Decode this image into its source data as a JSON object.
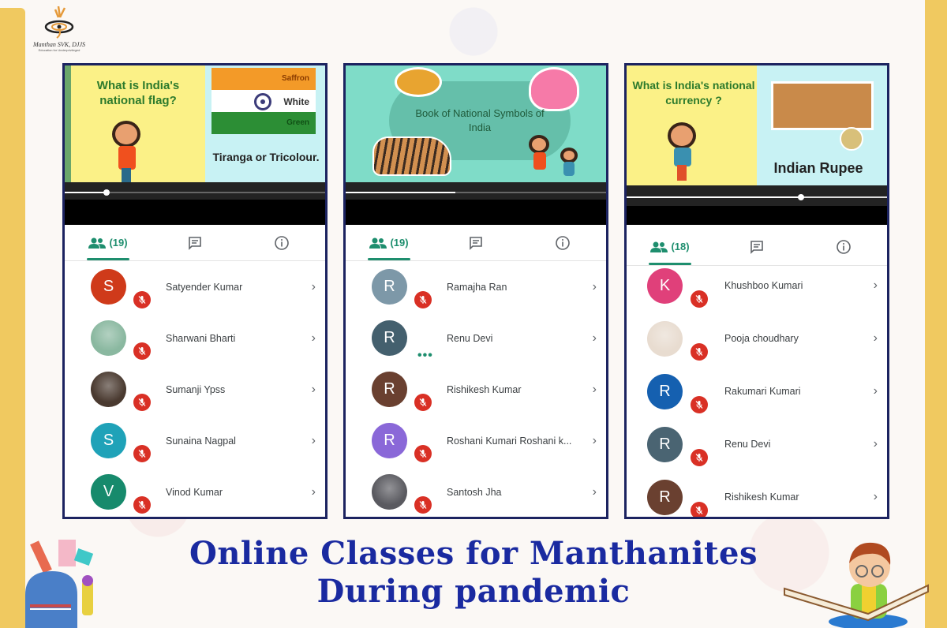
{
  "logo": {
    "title": "Manthan SVK, DJJS",
    "subtitle": "Education for Underprivileged"
  },
  "headline": {
    "line1": "Online Classes for Manthanites",
    "line2": "During pandemic"
  },
  "colors": {
    "accent_green": "#1e8e6e",
    "mute_red": "#d93025",
    "headline_blue": "#1a2aa0",
    "frame_navy": "#1c2360",
    "side_yellow": "#f0c960"
  },
  "phones": [
    {
      "video": {
        "question": "What is India's national flag?",
        "flag_labels": [
          "Saffron",
          "White",
          "Green"
        ],
        "caption": "Tiranga or Tricolour.",
        "progress": 0.16
      },
      "tabs": {
        "participants_count": "(19)",
        "people_icon": "people-icon",
        "chat_icon": "chat-icon",
        "info_icon": "info-icon"
      },
      "participants": [
        {
          "initial": "S",
          "name": "Satyender Kumar",
          "color": "#cf3a1a",
          "status": "muted"
        },
        {
          "initial": "",
          "name": "Sharwani Bharti",
          "color": "#8ab8a0",
          "status": "muted",
          "photo": true
        },
        {
          "initial": "",
          "name": "Sumanji Ypss",
          "color": "#4a3a30",
          "status": "muted",
          "photo": true
        },
        {
          "initial": "S",
          "name": "Sunaina Nagpal",
          "color": "#1fa2b8",
          "status": "muted"
        },
        {
          "initial": "V",
          "name": "Vinod Kumar",
          "color": "#178a6c",
          "status": "muted"
        }
      ]
    },
    {
      "video": {
        "title": "Book of National Symbols of India",
        "progress": 0.42
      },
      "tabs": {
        "participants_count": "(19)",
        "people_icon": "people-icon",
        "chat_icon": "chat-icon",
        "info_icon": "info-icon"
      },
      "participants": [
        {
          "initial": "R",
          "name": "Ramajha Ran",
          "color": "#7d98a8",
          "status": "muted"
        },
        {
          "initial": "R",
          "name": "Renu Devi",
          "color": "#44606e",
          "status": "speaking",
          "typing": "•••"
        },
        {
          "initial": "R",
          "name": "Rishikesh Kumar",
          "color": "#6a4030",
          "status": "muted"
        },
        {
          "initial": "R",
          "name": "Roshani Kumari Roshani k...",
          "color": "#8a68d8",
          "status": "muted"
        },
        {
          "initial": "",
          "name": "Santosh Jha",
          "color": "#5a5a60",
          "status": "muted",
          "photo": true
        }
      ]
    },
    {
      "video": {
        "question": "What is India's national currency ?",
        "caption": "Indian Rupee",
        "progress": 0.67
      },
      "tabs": {
        "participants_count": "(18)",
        "people_icon": "people-icon",
        "chat_icon": "chat-icon",
        "info_icon": "info-icon"
      },
      "participants": [
        {
          "initial": "K",
          "name": "Khushboo Kumari",
          "color": "#e0407a",
          "status": "muted"
        },
        {
          "initial": "",
          "name": "Pooja choudhary",
          "color": "#e8dcd0",
          "status": "muted",
          "photo": true
        },
        {
          "initial": "R",
          "name": "Rakumari Kumari",
          "color": "#1560b0",
          "status": "muted"
        },
        {
          "initial": "R",
          "name": "Renu Devi",
          "color": "#4a6472",
          "status": "muted"
        },
        {
          "initial": "R",
          "name": "Rishikesh Kumar",
          "color": "#6a4030",
          "status": "muted"
        }
      ]
    }
  ]
}
